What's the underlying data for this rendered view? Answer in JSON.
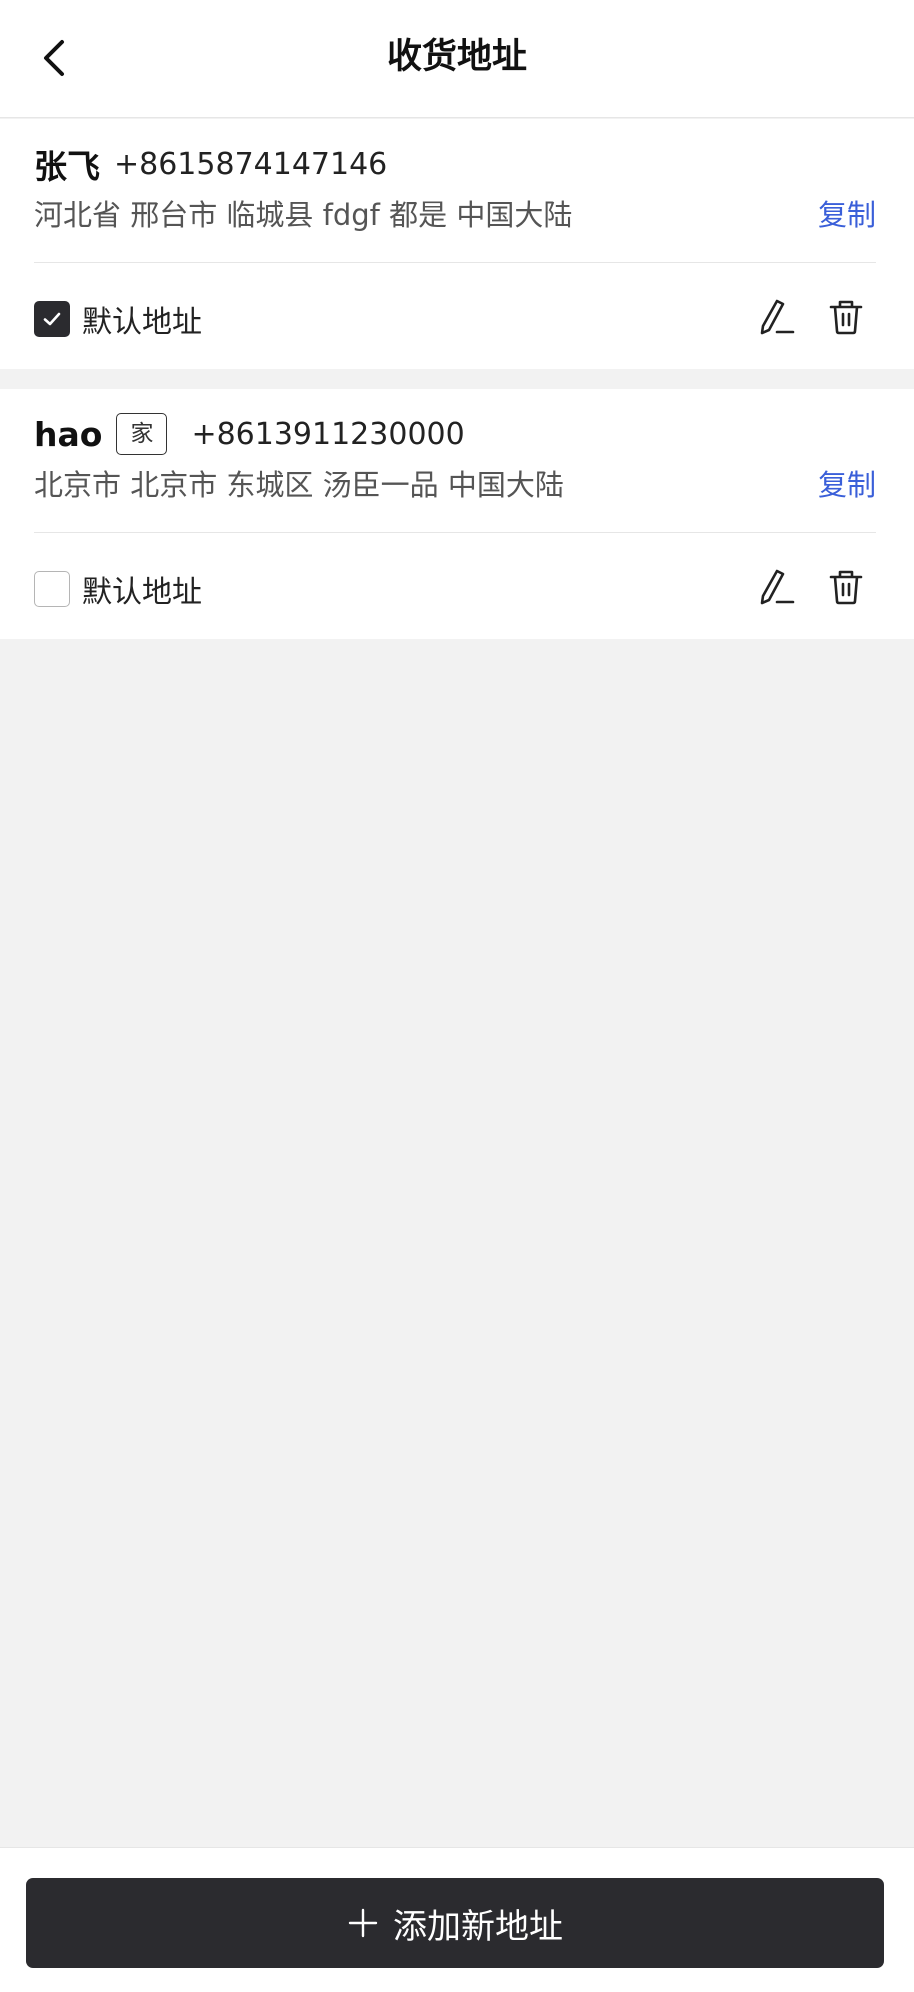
{
  "header": {
    "title": "收货地址",
    "back_icon": "chevron-left-icon"
  },
  "addresses": [
    {
      "name": "张飞",
      "tag": "",
      "phone": "+8615874147146",
      "address": "河北省 邢台市 临城县 fdgf 都是 中国大陆",
      "copy_label": "复制",
      "default_label": "默认地址",
      "is_default": true
    },
    {
      "name": "hao",
      "tag": "家",
      "phone": "+8613911230000",
      "address": "北京市 北京市 东城区 汤臣一品 中国大陆",
      "copy_label": "复制",
      "default_label": "默认地址",
      "is_default": false
    }
  ],
  "footer": {
    "add_label": "添加新地址"
  },
  "colors": {
    "accent": "#3a5fd9",
    "dark": "#2b2b2f",
    "background": "#f2f2f2"
  }
}
